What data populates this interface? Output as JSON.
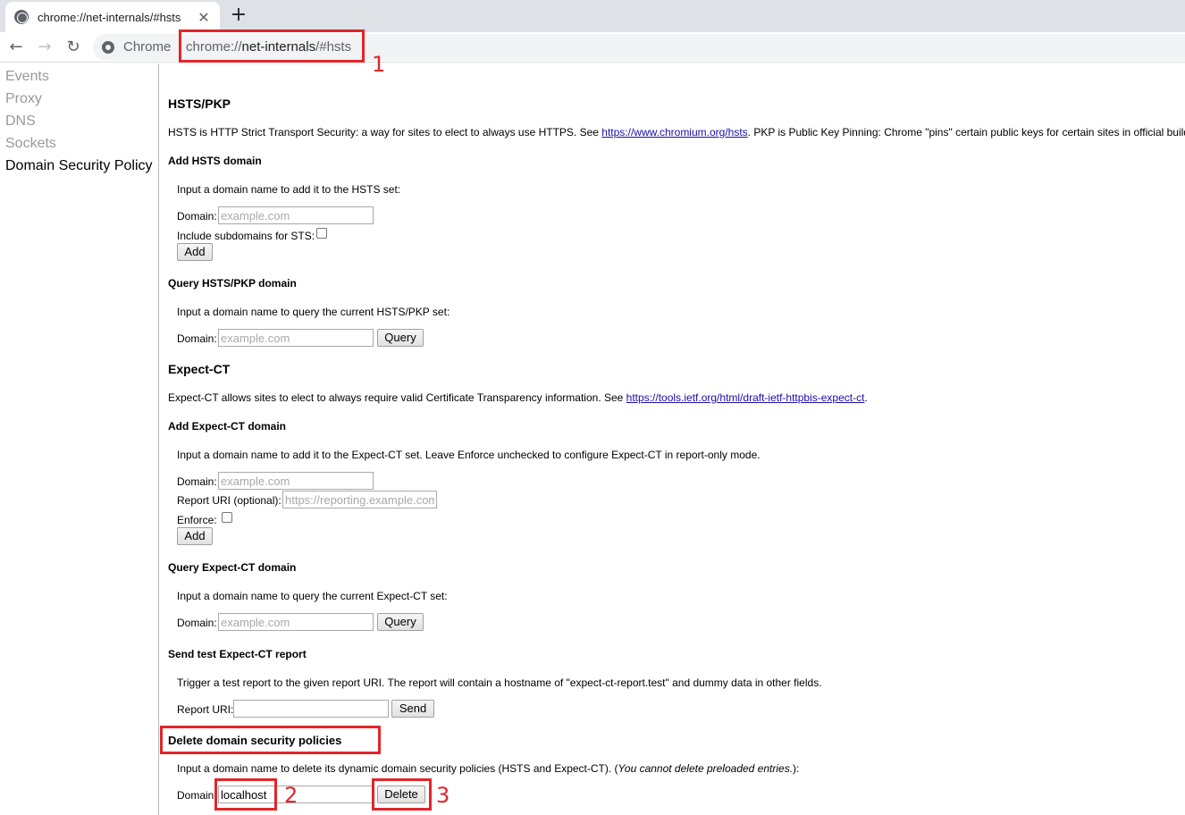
{
  "tab": {
    "title": "chrome://net-internals/#hsts",
    "close": "✕",
    "new_tab": "+"
  },
  "toolbar": {
    "back": "←",
    "forward": "→",
    "reload": "↻",
    "omni_label": "Chrome",
    "url_scheme": "chrome://",
    "url_host": "net-internals",
    "url_path": "/#hsts"
  },
  "sidebar": {
    "items": [
      {
        "label": "Events"
      },
      {
        "label": "Proxy"
      },
      {
        "label": "DNS"
      },
      {
        "label": "Sockets"
      },
      {
        "label": "Domain Security Policy",
        "active": true
      }
    ]
  },
  "hsts": {
    "title": "HSTS/PKP",
    "desc_pre": "HSTS is HTTP Strict Transport Security: a way for sites to elect to always use HTTPS. See ",
    "desc_link": "https://www.chromium.org/hsts",
    "desc_post": ". PKP is Public Key Pinning: Chrome \"pins\" certain public keys for certain sites in official builds.",
    "add": {
      "title": "Add HSTS domain",
      "instructions": "Input a domain name to add it to the HSTS set:",
      "domain_label": "Domain:",
      "domain_placeholder": "example.com",
      "subdomains_label": "Include subdomains for STS:",
      "button": "Add"
    },
    "query": {
      "title": "Query HSTS/PKP domain",
      "instructions": "Input a domain name to query the current HSTS/PKP set:",
      "domain_label": "Domain:",
      "domain_placeholder": "example.com",
      "button": "Query"
    }
  },
  "expect_ct": {
    "title": "Expect-CT",
    "desc_pre": "Expect-CT allows sites to elect to always require valid Certificate Transparency information. See ",
    "desc_link": "https://tools.ietf.org/html/draft-ietf-httpbis-expect-ct",
    "desc_post": ".",
    "add": {
      "title": "Add Expect-CT domain",
      "instructions": "Input a domain name to add it to the Expect-CT set. Leave Enforce unchecked to configure Expect-CT in report-only mode.",
      "domain_label": "Domain:",
      "domain_placeholder": "example.com",
      "report_label": "Report URI (optional):",
      "report_placeholder": "https://reporting.example.com",
      "enforce_label": "Enforce:",
      "button": "Add"
    },
    "query": {
      "title": "Query Expect-CT domain",
      "instructions": "Input a domain name to query the current Expect-CT set:",
      "domain_label": "Domain:",
      "domain_placeholder": "example.com",
      "button": "Query"
    },
    "test": {
      "title": "Send test Expect-CT report",
      "instructions": "Trigger a test report to the given report URI. The report will contain a hostname of \"expect-ct-report.test\" and dummy data in other fields.",
      "report_label": "Report URI:",
      "button": "Send"
    }
  },
  "delete": {
    "title": "Delete domain security policies",
    "instructions_pre": "Input a domain name to delete its dynamic domain security policies (HSTS and Expect-CT). (",
    "instructions_em": "You cannot delete preloaded entries.",
    "instructions_post": "):",
    "domain_label": "Domain:",
    "domain_value": "localhost",
    "button": "Delete"
  },
  "annotations": {
    "one": "1",
    "two": "2",
    "three": "3",
    "color": "#e0262b"
  }
}
